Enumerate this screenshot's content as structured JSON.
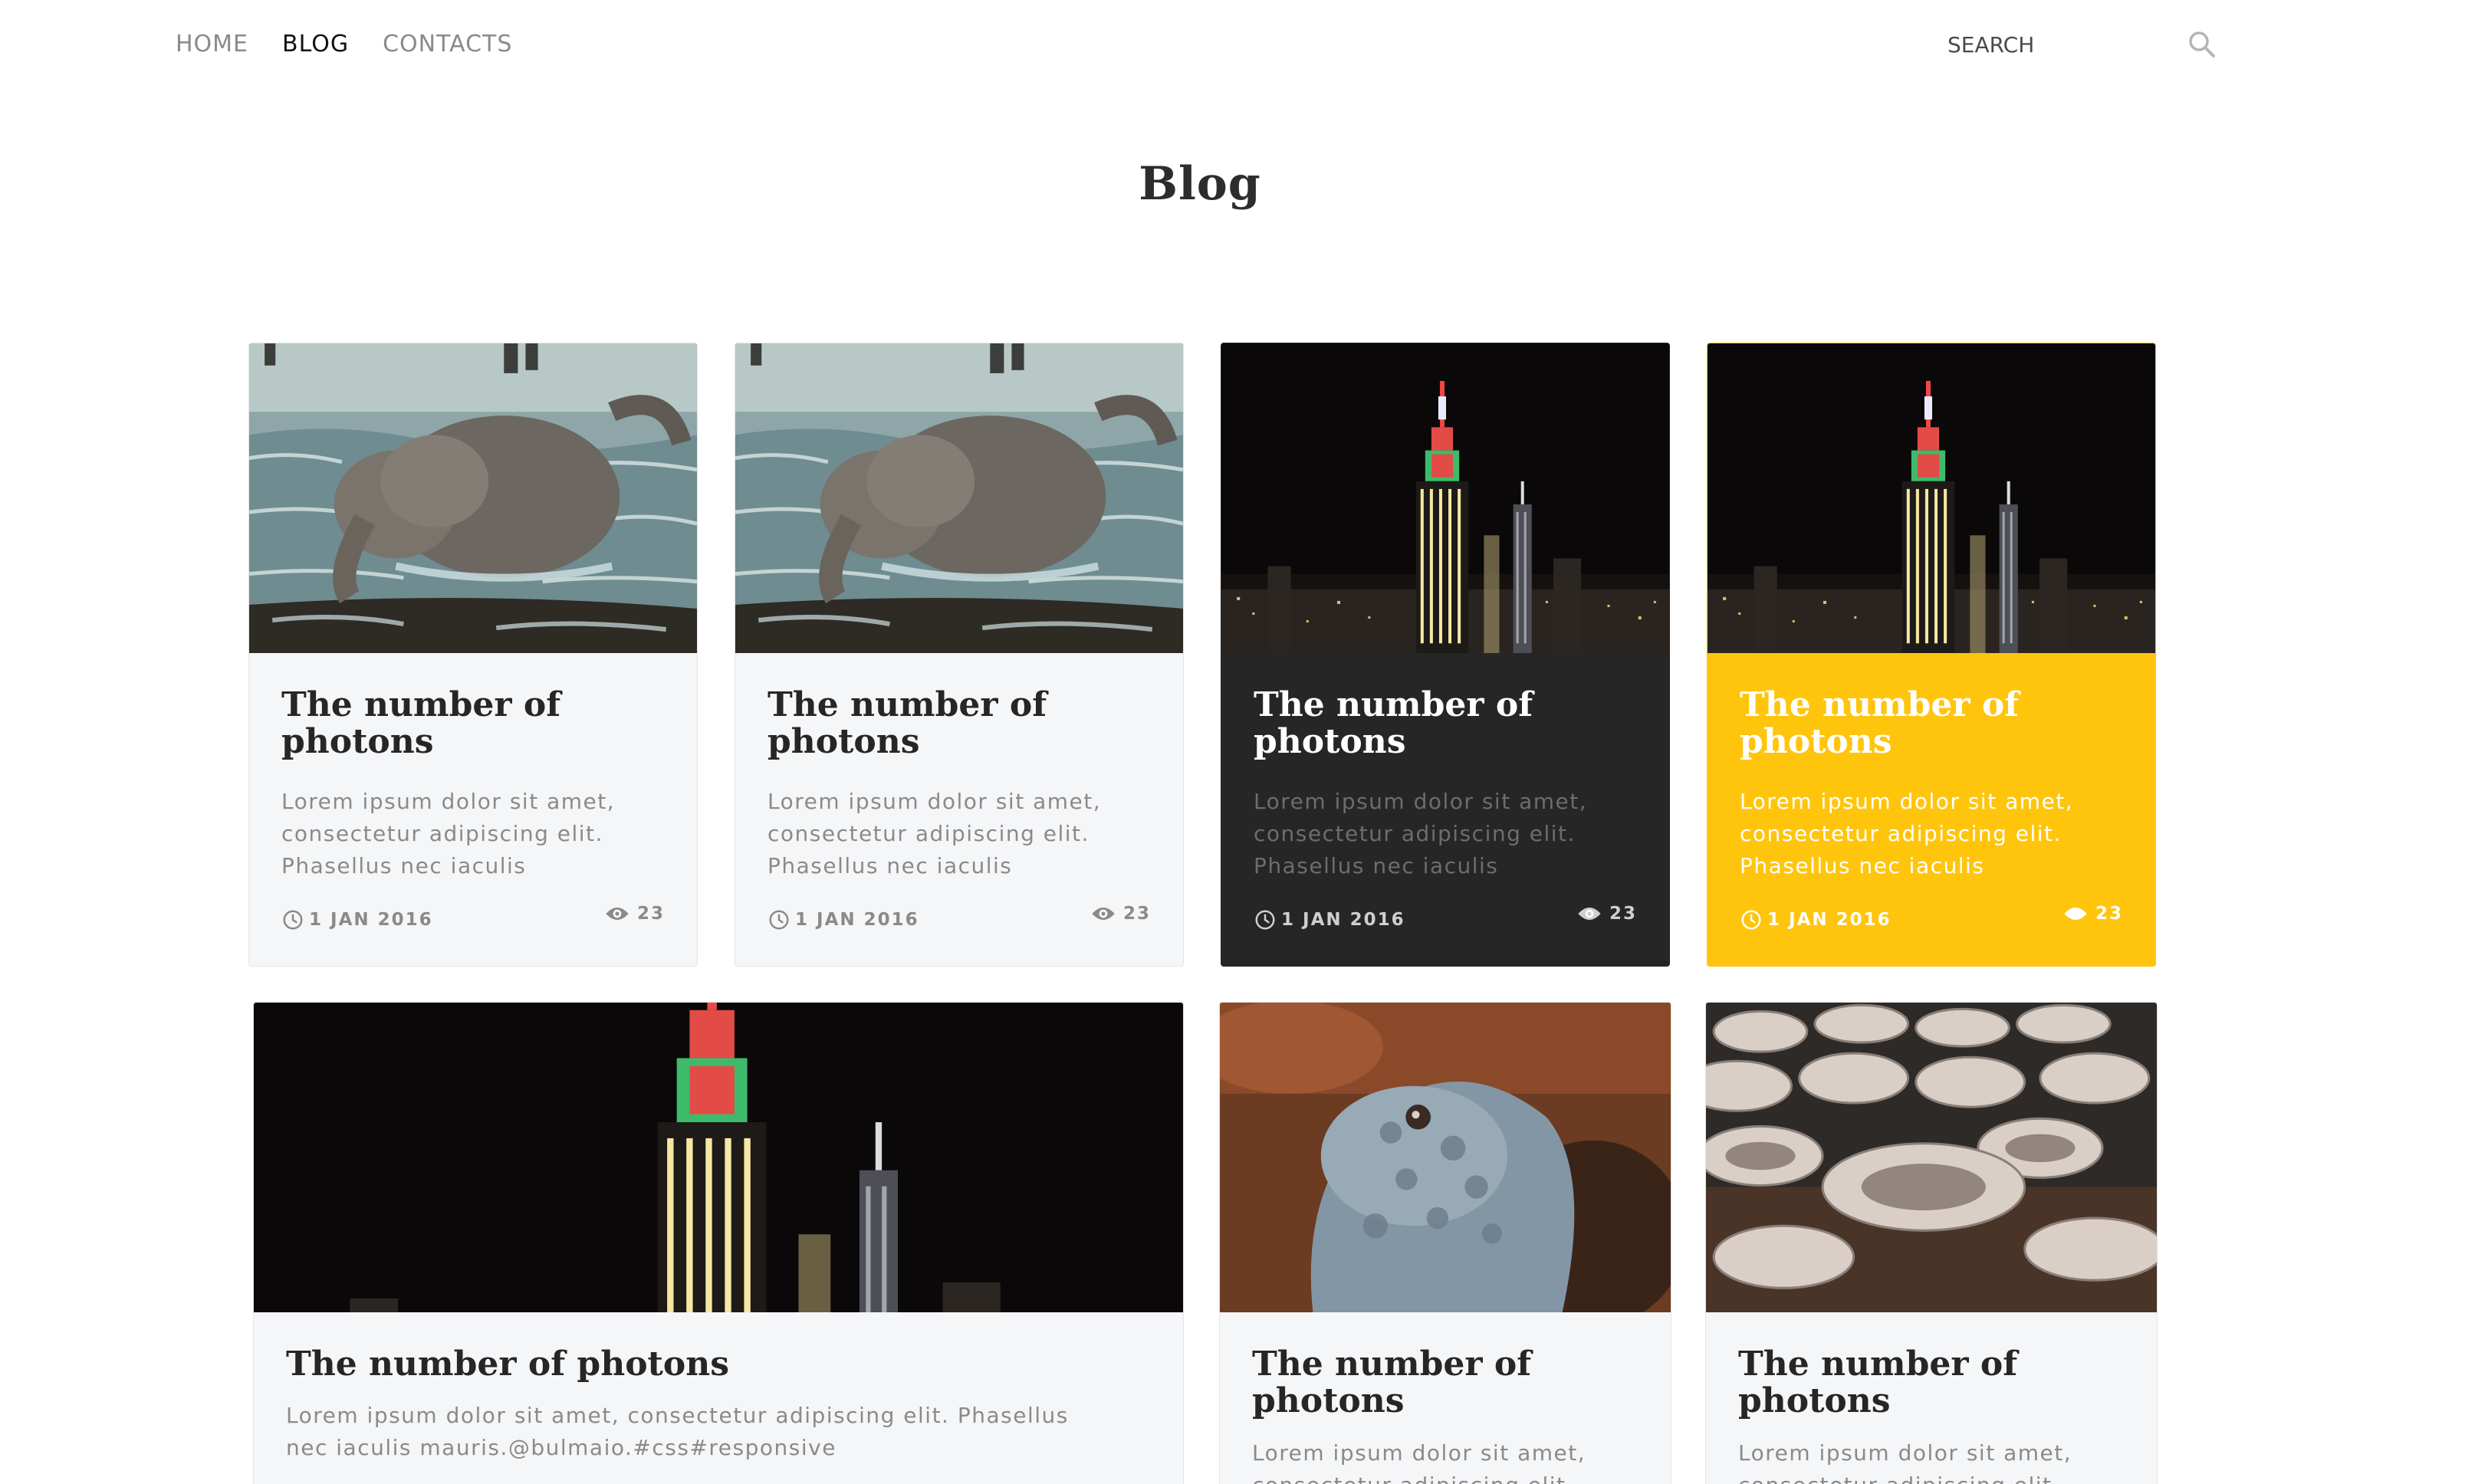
{
  "nav": {
    "links": [
      {
        "label": "HOME",
        "active": false
      },
      {
        "label": "BLOG",
        "active": true
      },
      {
        "label": "CONTACTS",
        "active": false
      }
    ],
    "search_placeholder": "SEARCH",
    "search_icon": "magnifier-icon"
  },
  "page": {
    "title": "Blog"
  },
  "colors": {
    "accent_yellow": "#ffc50d",
    "dark_card": "#262626",
    "light_card": "#f5f6f8",
    "muted_text": "#8a8a8a"
  },
  "cards": [
    {
      "style": "light",
      "image": "elephant",
      "title": "The number of photons",
      "text": "Lorem ipsum dolor sit amet, consectetur adipiscing elit. Phasellus nec iaculis",
      "date": "1 JAN 2016",
      "views": "23"
    },
    {
      "style": "light",
      "image": "elephant",
      "title": "The number of photons",
      "text": "Lorem ipsum dolor sit amet, consectetur adipiscing elit. Phasellus nec iaculis",
      "date": "1 JAN 2016",
      "views": "23"
    },
    {
      "style": "dark",
      "image": "night-city",
      "title": "The number of photons",
      "text": "Lorem ipsum dolor sit amet, consectetur adipiscing elit. Phasellus nec iaculis",
      "date": "1 JAN 2016",
      "views": "23"
    },
    {
      "style": "yellow",
      "image": "night-city",
      "title": "The number of photons",
      "text": "Lorem ipsum dolor sit amet, consectetur adipiscing elit. Phasellus nec iaculis",
      "date": "1 JAN 2016",
      "views": "23"
    },
    {
      "style": "light",
      "image": "night-city-wide",
      "title": "The number of photons",
      "text": "Lorem ipsum dolor sit amet, consectetur adipiscing elit. Phasellus nec iaculis mauris.@bulmaio.#css#responsive"
    },
    {
      "style": "light",
      "image": "iguana",
      "title": "The number of photons",
      "text": "Lorem ipsum dolor sit amet, consectetur adipiscing elit."
    },
    {
      "style": "light",
      "image": "cheese",
      "title": "The number of photons",
      "text": "Lorem ipsum dolor sit amet, consectetur adipiscing elit."
    }
  ]
}
